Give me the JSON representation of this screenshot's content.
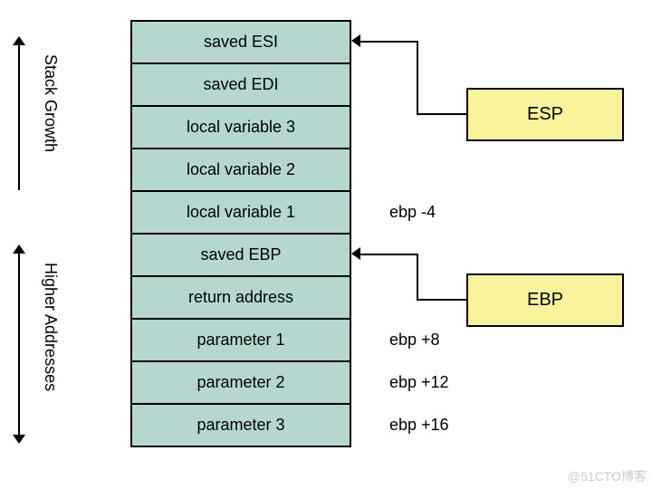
{
  "labels": {
    "stack_growth": "Stack Growth",
    "higher_addresses": "Higher Addresses"
  },
  "stack": [
    "saved ESI",
    "saved EDI",
    "local variable 3",
    "local variable 2",
    "local variable 1",
    "saved EBP",
    "return address",
    "parameter 1",
    "parameter 2",
    "parameter 3"
  ],
  "registers": {
    "esp": "ESP",
    "ebp": "EBP"
  },
  "offsets": {
    "lv1": "ebp -4",
    "p1": "ebp +8",
    "p2": "ebp +12",
    "p3": "ebp +16"
  },
  "watermark": "@51CTO博客"
}
